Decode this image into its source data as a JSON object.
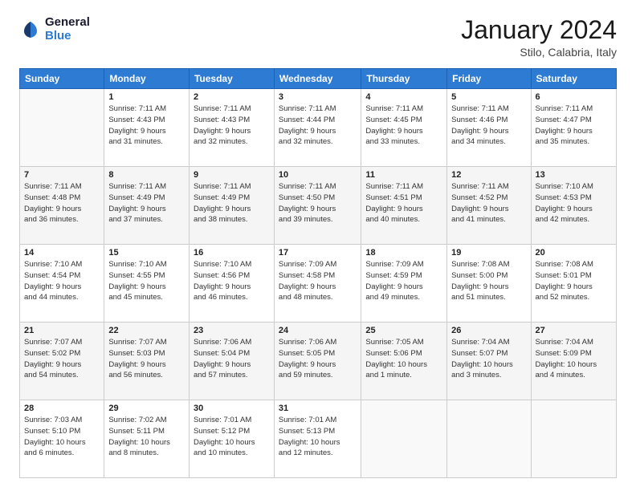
{
  "logo": {
    "line1": "General",
    "line2": "Blue"
  },
  "title": "January 2024",
  "subtitle": "Stilo, Calabria, Italy",
  "header_days": [
    "Sunday",
    "Monday",
    "Tuesday",
    "Wednesday",
    "Thursday",
    "Friday",
    "Saturday"
  ],
  "weeks": [
    [
      {
        "day": "",
        "info": ""
      },
      {
        "day": "1",
        "info": "Sunrise: 7:11 AM\nSunset: 4:43 PM\nDaylight: 9 hours\nand 31 minutes."
      },
      {
        "day": "2",
        "info": "Sunrise: 7:11 AM\nSunset: 4:43 PM\nDaylight: 9 hours\nand 32 minutes."
      },
      {
        "day": "3",
        "info": "Sunrise: 7:11 AM\nSunset: 4:44 PM\nDaylight: 9 hours\nand 32 minutes."
      },
      {
        "day": "4",
        "info": "Sunrise: 7:11 AM\nSunset: 4:45 PM\nDaylight: 9 hours\nand 33 minutes."
      },
      {
        "day": "5",
        "info": "Sunrise: 7:11 AM\nSunset: 4:46 PM\nDaylight: 9 hours\nand 34 minutes."
      },
      {
        "day": "6",
        "info": "Sunrise: 7:11 AM\nSunset: 4:47 PM\nDaylight: 9 hours\nand 35 minutes."
      }
    ],
    [
      {
        "day": "7",
        "info": "Sunrise: 7:11 AM\nSunset: 4:48 PM\nDaylight: 9 hours\nand 36 minutes."
      },
      {
        "day": "8",
        "info": "Sunrise: 7:11 AM\nSunset: 4:49 PM\nDaylight: 9 hours\nand 37 minutes."
      },
      {
        "day": "9",
        "info": "Sunrise: 7:11 AM\nSunset: 4:49 PM\nDaylight: 9 hours\nand 38 minutes."
      },
      {
        "day": "10",
        "info": "Sunrise: 7:11 AM\nSunset: 4:50 PM\nDaylight: 9 hours\nand 39 minutes."
      },
      {
        "day": "11",
        "info": "Sunrise: 7:11 AM\nSunset: 4:51 PM\nDaylight: 9 hours\nand 40 minutes."
      },
      {
        "day": "12",
        "info": "Sunrise: 7:11 AM\nSunset: 4:52 PM\nDaylight: 9 hours\nand 41 minutes."
      },
      {
        "day": "13",
        "info": "Sunrise: 7:10 AM\nSunset: 4:53 PM\nDaylight: 9 hours\nand 42 minutes."
      }
    ],
    [
      {
        "day": "14",
        "info": "Sunrise: 7:10 AM\nSunset: 4:54 PM\nDaylight: 9 hours\nand 44 minutes."
      },
      {
        "day": "15",
        "info": "Sunrise: 7:10 AM\nSunset: 4:55 PM\nDaylight: 9 hours\nand 45 minutes."
      },
      {
        "day": "16",
        "info": "Sunrise: 7:10 AM\nSunset: 4:56 PM\nDaylight: 9 hours\nand 46 minutes."
      },
      {
        "day": "17",
        "info": "Sunrise: 7:09 AM\nSunset: 4:58 PM\nDaylight: 9 hours\nand 48 minutes."
      },
      {
        "day": "18",
        "info": "Sunrise: 7:09 AM\nSunset: 4:59 PM\nDaylight: 9 hours\nand 49 minutes."
      },
      {
        "day": "19",
        "info": "Sunrise: 7:08 AM\nSunset: 5:00 PM\nDaylight: 9 hours\nand 51 minutes."
      },
      {
        "day": "20",
        "info": "Sunrise: 7:08 AM\nSunset: 5:01 PM\nDaylight: 9 hours\nand 52 minutes."
      }
    ],
    [
      {
        "day": "21",
        "info": "Sunrise: 7:07 AM\nSunset: 5:02 PM\nDaylight: 9 hours\nand 54 minutes."
      },
      {
        "day": "22",
        "info": "Sunrise: 7:07 AM\nSunset: 5:03 PM\nDaylight: 9 hours\nand 56 minutes."
      },
      {
        "day": "23",
        "info": "Sunrise: 7:06 AM\nSunset: 5:04 PM\nDaylight: 9 hours\nand 57 minutes."
      },
      {
        "day": "24",
        "info": "Sunrise: 7:06 AM\nSunset: 5:05 PM\nDaylight: 9 hours\nand 59 minutes."
      },
      {
        "day": "25",
        "info": "Sunrise: 7:05 AM\nSunset: 5:06 PM\nDaylight: 10 hours\nand 1 minute."
      },
      {
        "day": "26",
        "info": "Sunrise: 7:04 AM\nSunset: 5:07 PM\nDaylight: 10 hours\nand 3 minutes."
      },
      {
        "day": "27",
        "info": "Sunrise: 7:04 AM\nSunset: 5:09 PM\nDaylight: 10 hours\nand 4 minutes."
      }
    ],
    [
      {
        "day": "28",
        "info": "Sunrise: 7:03 AM\nSunset: 5:10 PM\nDaylight: 10 hours\nand 6 minutes."
      },
      {
        "day": "29",
        "info": "Sunrise: 7:02 AM\nSunset: 5:11 PM\nDaylight: 10 hours\nand 8 minutes."
      },
      {
        "day": "30",
        "info": "Sunrise: 7:01 AM\nSunset: 5:12 PM\nDaylight: 10 hours\nand 10 minutes."
      },
      {
        "day": "31",
        "info": "Sunrise: 7:01 AM\nSunset: 5:13 PM\nDaylight: 10 hours\nand 12 minutes."
      },
      {
        "day": "",
        "info": ""
      },
      {
        "day": "",
        "info": ""
      },
      {
        "day": "",
        "info": ""
      }
    ]
  ]
}
